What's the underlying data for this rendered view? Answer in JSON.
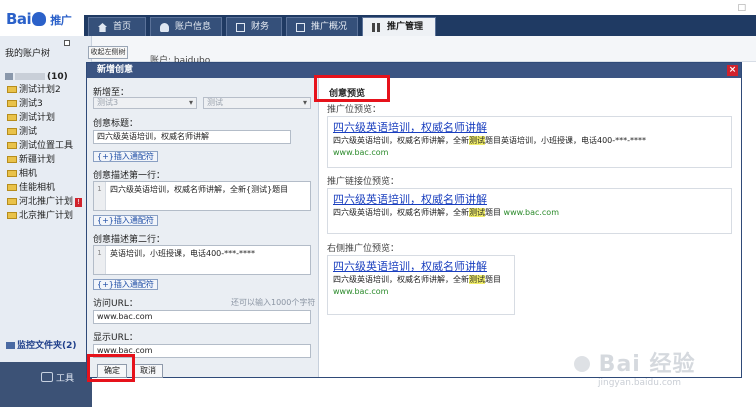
{
  "app": {
    "logo_text": "Bai",
    "logo_cn": "推广",
    "top_controls": "□"
  },
  "nav": {
    "tabs": [
      {
        "label": "首页",
        "icon": "home-icon"
      },
      {
        "label": "账户信息",
        "icon": "user-icon"
      },
      {
        "label": "财务",
        "icon": "money-icon"
      },
      {
        "label": "推广概况",
        "icon": "chart-icon"
      },
      {
        "label": "推广管理",
        "icon": "grid-icon",
        "active": true
      }
    ]
  },
  "sidebar": {
    "title": "我的账户树",
    "collapse_label": "收起左侧树",
    "account_count": "(10)",
    "plans": [
      {
        "label": "测试计划2"
      },
      {
        "label": "测试3"
      },
      {
        "label": "测试计划"
      },
      {
        "label": "测试"
      },
      {
        "label": "测试位置工具"
      },
      {
        "label": "新疆计划"
      },
      {
        "label": "相机"
      },
      {
        "label": "佳能相机"
      },
      {
        "label": "河北推广计划",
        "flag": "!"
      },
      {
        "label": "北京推广计划"
      }
    ],
    "monitor_label": "监控文件夹(2)",
    "toolbox_label": "工具"
  },
  "main": {
    "account_label": "账户: baidubo"
  },
  "modal": {
    "title": "新增创意",
    "close_label": "×",
    "form": {
      "add_to_label": "新增至：",
      "plan_select": "测试3",
      "unit_select": "测试",
      "title_label": "创意标题：",
      "title_value": "四六级英语培训，权威名师讲解",
      "insert_wildcard": "{+}插入通配符",
      "desc1_label": "创意描述第一行：",
      "desc1_value": "四六级英语培训，权威名师讲解，全新{测试}题目",
      "desc2_label": "创意描述第二行：",
      "desc2_value": "英语培训，小班授课，电话400-***-****",
      "line_no": "1",
      "visit_url_label": "访问URL：",
      "visit_url_hint": "还可以输入1000个字符",
      "visit_url_value": "www.bac.com",
      "display_url_label": "显示URL：",
      "display_url_value": "www.bac.com",
      "confirm_label": "确定",
      "cancel_label": "取消"
    },
    "preview": {
      "header": "创意预览",
      "left_section": "推广位预览：",
      "link_section": "推广链接位预览：",
      "right_section": "右侧推广位预览：",
      "ad_title": "四六级英语培训，权威名师讲解",
      "left_desc_before": "四六级英语培训，权威名师讲解，全新",
      "keyword": "测试",
      "left_desc_after": "题目英语培训，小班授课，电话400-***-****",
      "url": "www.bac.com",
      "link_desc_before": "四六级英语培训，权威名师讲解，全新",
      "link_desc_after": "题目",
      "right_desc_before": "四六级英语培训，权威名师讲解，全新",
      "right_desc_after": "题目"
    }
  },
  "watermark": {
    "brand": "Bai  经验",
    "url": "jingyan.baidu.com"
  },
  "colors": {
    "nav_bg": "#1f3a63",
    "modal_head": "#3b5482",
    "highlight_red": "#e6121b",
    "link_blue": "#1a3fbf",
    "url_green": "#2a8a2a",
    "keyword_highlight": "#f2ef6a"
  }
}
